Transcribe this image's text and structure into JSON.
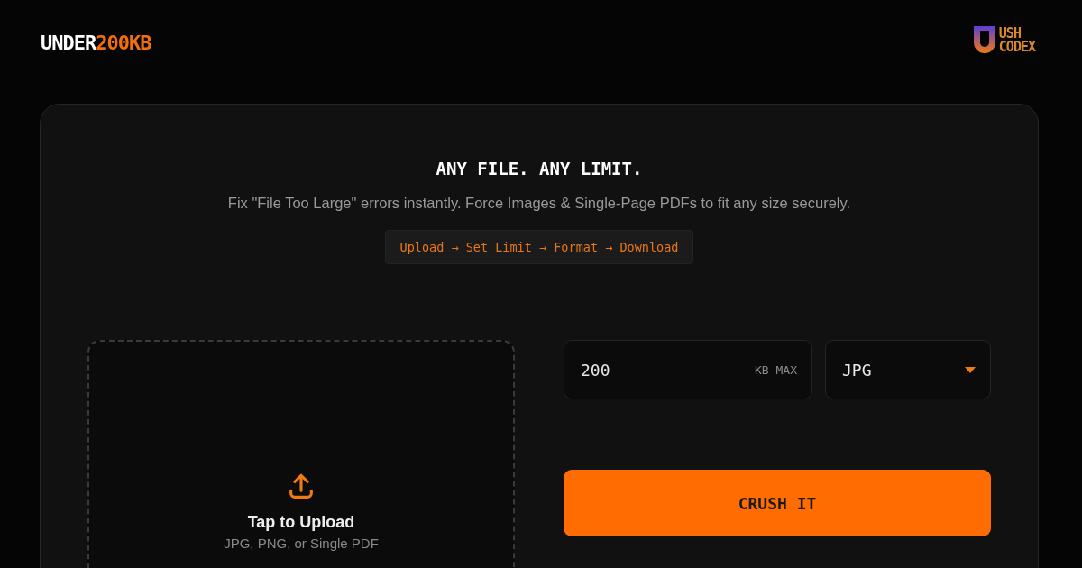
{
  "header": {
    "brand": {
      "part_1": "UNDER",
      "part_2": "200KB"
    },
    "partner_logo": {
      "line_1": "USH",
      "line_2": "CODEX"
    }
  },
  "hero": {
    "title": "ANY FILE. ANY LIMIT.",
    "subtitle": "Fix \"File Too Large\" errors instantly. Force Images & Single-Page PDFs to fit any size securely.",
    "steps": "Upload → Set Limit → Format → Download"
  },
  "upload": {
    "title": "Tap to Upload",
    "hint": "JPG, PNG, or Single PDF"
  },
  "size_field": {
    "value": "200",
    "unit": "KB MAX"
  },
  "format_select": {
    "value": "JPG"
  },
  "action_button": "CRUSH IT"
}
